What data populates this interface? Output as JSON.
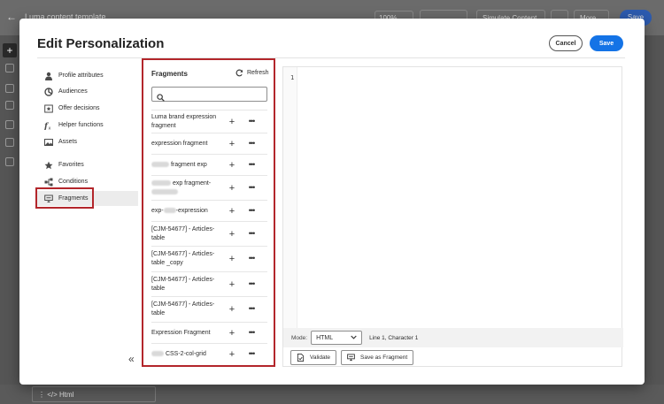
{
  "background": {
    "title": "Luma content template",
    "zoom": "100%",
    "simulate_label": "Simulate Content",
    "more_label": "More",
    "save_label": "Save",
    "bottom_item": "Html"
  },
  "modal": {
    "title": "Edit Personalization",
    "cancel_label": "Cancel",
    "save_label": "Save"
  },
  "nav": {
    "items": [
      {
        "label": "Profile attributes",
        "icon": "person-icon"
      },
      {
        "label": "Audiences",
        "icon": "audiences-icon"
      },
      {
        "label": "Offer decisions",
        "icon": "offer-icon"
      },
      {
        "label": "Helper functions",
        "icon": "function-icon"
      },
      {
        "label": "Assets",
        "icon": "image-icon"
      },
      {
        "label": "Favorites",
        "icon": "star-icon"
      },
      {
        "label": "Conditions",
        "icon": "branch-icon"
      },
      {
        "label": "Fragments",
        "icon": "fragment-icon"
      }
    ]
  },
  "fragments": {
    "title": "Fragments",
    "refresh_label": "Refresh",
    "search_placeholder": "",
    "items": [
      {
        "prefix": "",
        "label": "Luma brand expression fragment"
      },
      {
        "prefix": "",
        "label": "expression fragment"
      },
      {
        "prefix": "",
        "label": "fragment exp"
      },
      {
        "prefix": "",
        "label": "exp fragment-"
      },
      {
        "prefix": "exp-",
        "label": "-expression"
      },
      {
        "prefix": "",
        "label": "[CJM-54677] - Articles-table"
      },
      {
        "prefix": "",
        "label": "[CJM-54677] - Articles-table _copy"
      },
      {
        "prefix": "",
        "label": "[CJM-54677] - Articles-table"
      },
      {
        "prefix": "",
        "label": "[CJM-54677] - Articles-table"
      },
      {
        "prefix": "",
        "label": "Expression Fragment"
      },
      {
        "prefix": "",
        "label": "CSS-2-col-grid"
      }
    ]
  },
  "editor": {
    "line_number": "1",
    "mode_label": "Mode:",
    "mode_value": "HTML",
    "line_info": "Line 1, Character 1",
    "validate_label": "Validate",
    "save_fragment_label": "Save as Fragment"
  }
}
